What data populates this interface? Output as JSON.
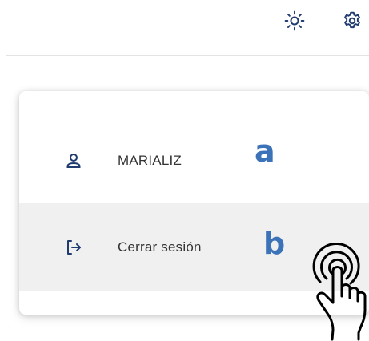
{
  "header": {
    "theme_icon": "sun-icon",
    "settings_icon": "gear-icon"
  },
  "menu": {
    "items": [
      {
        "label": "MARIALIZ",
        "icon": "user-icon"
      },
      {
        "label": "Cerrar sesión",
        "icon": "logout-icon"
      }
    ]
  },
  "annotations": {
    "a": "a",
    "b": "b"
  },
  "colors": {
    "icon_navy": "#1f3b70",
    "annotation_blue": "#3c73b8",
    "hover_bg": "#f0f0f0"
  }
}
